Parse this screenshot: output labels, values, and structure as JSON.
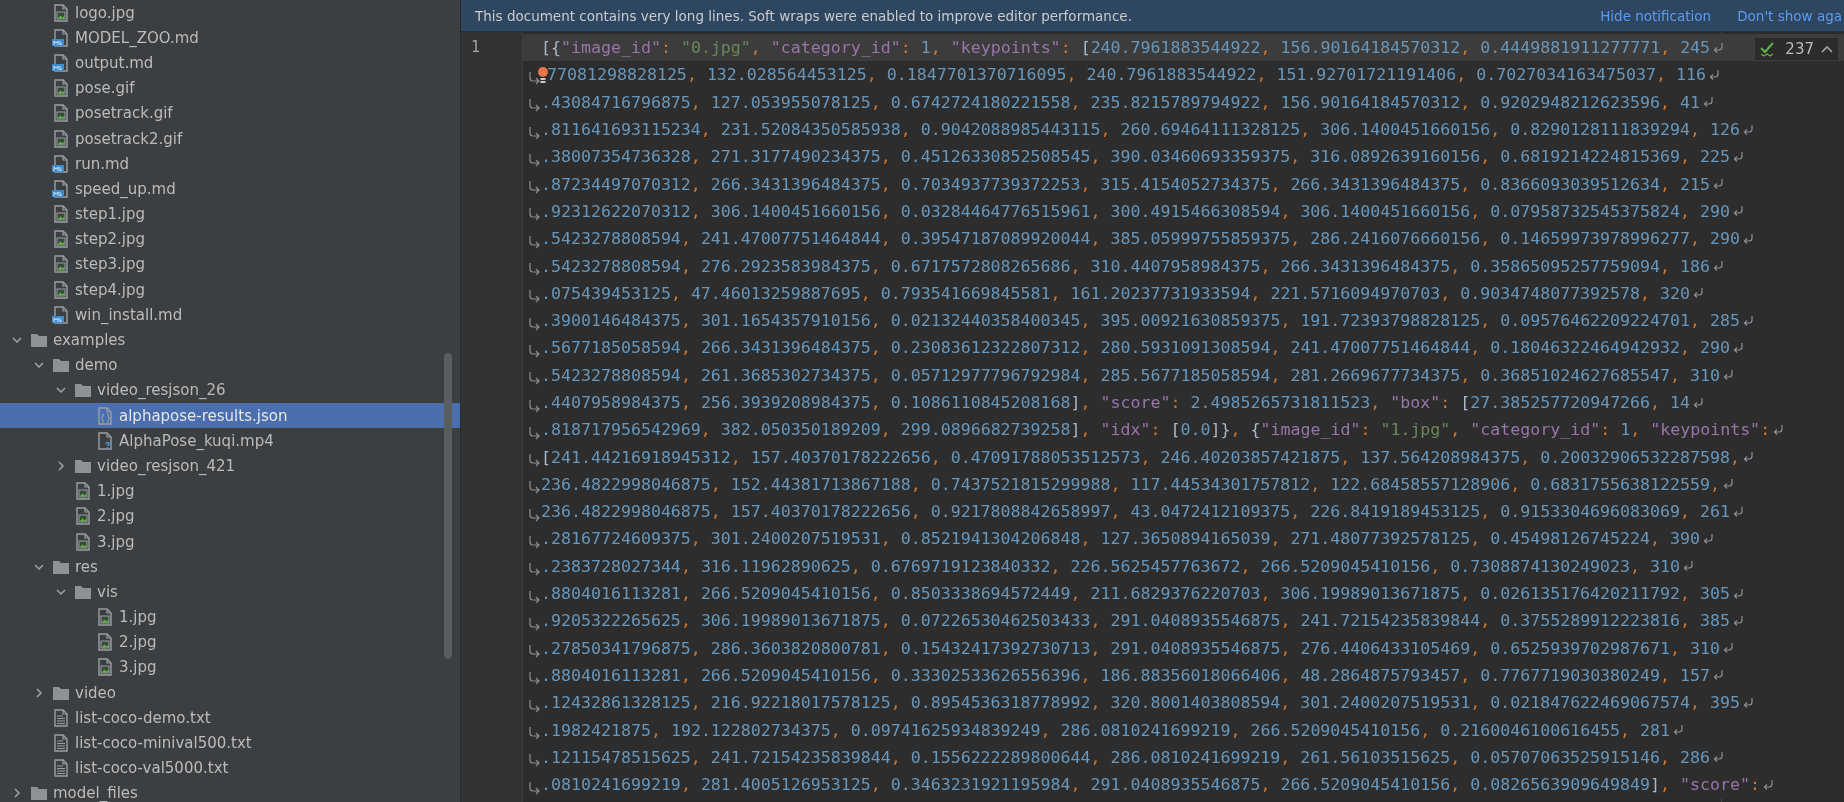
{
  "project_tree": {
    "items": [
      {
        "expanded": true,
        "children": [
          {
            "label": "logo.jpg",
            "kind": "image",
            "selected": false
          },
          {
            "label": "MODEL_ZOO.md",
            "kind": "markdown",
            "selected": false
          },
          {
            "label": "output.md",
            "kind": "markdown",
            "selected": false
          },
          {
            "label": "pose.gif",
            "kind": "image",
            "selected": false
          },
          {
            "label": "posetrack.gif",
            "kind": "image",
            "selected": false
          },
          {
            "label": "posetrack2.gif",
            "kind": "image",
            "selected": false
          },
          {
            "label": "run.md",
            "kind": "markdown",
            "selected": false
          },
          {
            "label": "speed_up.md",
            "kind": "markdown",
            "selected": false
          },
          {
            "label": "step1.jpg",
            "kind": "image",
            "selected": false
          },
          {
            "label": "step2.jpg",
            "kind": "image",
            "selected": false
          },
          {
            "label": "step3.jpg",
            "kind": "image",
            "selected": false
          },
          {
            "label": "step4.jpg",
            "kind": "image",
            "selected": false
          },
          {
            "label": "win_install.md",
            "kind": "markdown",
            "selected": false
          }
        ]
      },
      {
        "label": "examples",
        "kind": "folder",
        "expanded": true,
        "selected": false,
        "children": [
          {
            "label": "demo",
            "kind": "folder",
            "expanded": true,
            "selected": false,
            "children": [
              {
                "label": "video_resjson_26",
                "kind": "folder",
                "expanded": true,
                "selected": false,
                "children": [
                  {
                    "label": "alphapose-results.json",
                    "kind": "json",
                    "selected": true
                  },
                  {
                    "label": "AlphaPose_kuqi.mp4",
                    "kind": "unknown",
                    "selected": false
                  }
                ]
              },
              {
                "label": "video_resjson_421",
                "kind": "folder",
                "expanded": false,
                "selected": false
              },
              {
                "label": "1.jpg",
                "kind": "image",
                "selected": false
              },
              {
                "label": "2.jpg",
                "kind": "image",
                "selected": false
              },
              {
                "label": "3.jpg",
                "kind": "image",
                "selected": false
              }
            ]
          },
          {
            "label": "res",
            "kind": "folder",
            "expanded": true,
            "selected": false,
            "children": [
              {
                "label": "vis",
                "kind": "folder",
                "expanded": true,
                "selected": false,
                "children": [
                  {
                    "label": "1.jpg",
                    "kind": "image",
                    "selected": false
                  },
                  {
                    "label": "2.jpg",
                    "kind": "image",
                    "selected": false
                  },
                  {
                    "label": "3.jpg",
                    "kind": "image",
                    "selected": false
                  }
                ]
              }
            ]
          },
          {
            "label": "video",
            "kind": "folder",
            "expanded": false,
            "selected": false
          },
          {
            "label": "list-coco-demo.txt",
            "kind": "text",
            "selected": false
          },
          {
            "label": "list-coco-minival500.txt",
            "kind": "text",
            "selected": false
          },
          {
            "label": "list-coco-val5000.txt",
            "kind": "text",
            "selected": false
          }
        ]
      },
      {
        "label": "model_files",
        "kind": "folder",
        "expanded": false,
        "selected": false
      }
    ]
  },
  "notification": {
    "message": "This document contains very long lines. Soft wraps were enabled to improve editor performance.",
    "actions": [
      "Hide notification",
      "Don't show aga"
    ]
  },
  "editor": {
    "line_numbers": [
      "1"
    ],
    "inspection_count": "237",
    "lines": [
      {
        "text": "[{\"image_id\": \"0.jpg\", \"category_id\": 1, \"keypoints\": [240.7961883544922, 156.90164184570312, 0.4449881911277771, 245",
        "wrap_start": false,
        "wrap_end": true,
        "bulb": false,
        "current": true
      },
      {
        "text": "77081298828125, 132.028564453125, 0.1847701370716095, 240.7961883544922, 151.92701721191406, 0.7027034163475037, 116",
        "wrap_start": true,
        "wrap_end": true,
        "bulb": true,
        "current": false
      },
      {
        "text": ".43084716796875, 127.053955078125, 0.6742724180221558, 235.8215789794922, 156.90164184570312, 0.9202948212623596, 41",
        "wrap_start": true,
        "wrap_end": true,
        "bulb": false,
        "current": false
      },
      {
        "text": ".811641693115234, 231.52084350585938, 0.9042088985443115, 260.69464111328125, 306.1400451660156, 0.8290128111839294, 126",
        "wrap_start": true,
        "wrap_end": true,
        "bulb": false,
        "current": false
      },
      {
        "text": ".38007354736328, 271.3177490234375, 0.45126330852508545, 390.03460693359375, 316.0892639160156, 0.6819214224815369, 225",
        "wrap_start": true,
        "wrap_end": true,
        "bulb": false,
        "current": false
      },
      {
        "text": ".87234497070312, 266.3431396484375, 0.7034937739372253, 315.4154052734375, 266.3431396484375, 0.8366093039512634, 215",
        "wrap_start": true,
        "wrap_end": true,
        "bulb": false,
        "current": false
      },
      {
        "text": ".92312622070312, 306.1400451660156, 0.03284464776515961, 300.4915466308594, 306.1400451660156, 0.07958732545375824, 290",
        "wrap_start": true,
        "wrap_end": true,
        "bulb": false,
        "current": false
      },
      {
        "text": ".5423278808594, 241.47007751464844, 0.39547187089920044, 385.05999755859375, 286.2416076660156, 0.14659973978996277, 290",
        "wrap_start": true,
        "wrap_end": true,
        "bulb": false,
        "current": false
      },
      {
        "text": ".5423278808594, 276.2923583984375, 0.6717572808265686, 310.4407958984375, 266.3431396484375, 0.35865095257759094, 186",
        "wrap_start": true,
        "wrap_end": true,
        "bulb": false,
        "current": false
      },
      {
        "text": ".075439453125, 47.46013259887695, 0.793541669845581, 161.20237731933594, 221.5716094970703, 0.9034748077392578, 320",
        "wrap_start": true,
        "wrap_end": true,
        "bulb": false,
        "current": false
      },
      {
        "text": ".3900146484375, 301.1654357910156, 0.02132440358400345, 395.00921630859375, 191.72393798828125, 0.09576462209224701, 285",
        "wrap_start": true,
        "wrap_end": true,
        "bulb": false,
        "current": false
      },
      {
        "text": ".5677185058594, 266.3431396484375, 0.23083612322807312, 280.5931091308594, 241.47007751464844, 0.18046322464942932, 290",
        "wrap_start": true,
        "wrap_end": true,
        "bulb": false,
        "current": false
      },
      {
        "text": ".5423278808594, 261.3685302734375, 0.05712977796792984, 285.5677185058594, 281.2669677734375, 0.36851024627685547, 310",
        "wrap_start": true,
        "wrap_end": true,
        "bulb": false,
        "current": false
      },
      {
        "text": ".4407958984375, 256.3939208984375, 0.1086110845208168], \"score\": 2.4985265731811523, \"box\": [27.385257720947266, 14",
        "wrap_start": true,
        "wrap_end": true,
        "bulb": false,
        "current": false
      },
      {
        "text": ".818717956542969, 382.050350189209, 299.0896682739258], \"idx\": [0.0]}, {\"image_id\": \"1.jpg\", \"category_id\": 1, \"keypoints\":",
        "wrap_start": true,
        "wrap_end": true,
        "bulb": false,
        "current": false
      },
      {
        "text": "[241.44216918945312, 157.40370178222656, 0.47091788053512573, 246.40203857421875, 137.564208984375, 0.20032906532287598,",
        "wrap_start": true,
        "wrap_end": true,
        "bulb": false,
        "current": false
      },
      {
        "text": "236.4822998046875, 152.44381713867188, 0.7437521815299988, 117.44534301757812, 122.68458557128906, 0.6831755638122559,",
        "wrap_start": true,
        "wrap_end": true,
        "bulb": false,
        "current": false
      },
      {
        "text": "236.4822998046875, 157.40370178222656, 0.9217808842658997, 43.0472412109375, 226.8419189453125, 0.9153304696083069, 261",
        "wrap_start": true,
        "wrap_end": true,
        "bulb": false,
        "current": false
      },
      {
        "text": ".28167724609375, 301.2400207519531, 0.8521941304206848, 127.3650894165039, 271.48077392578125, 0.45498126745224, 390",
        "wrap_start": true,
        "wrap_end": true,
        "bulb": false,
        "current": false
      },
      {
        "text": ".2383728027344, 316.11962890625, 0.6769719123840332, 226.5625457763672, 266.5209045410156, 0.7308874130249023, 310",
        "wrap_start": true,
        "wrap_end": true,
        "bulb": false,
        "current": false
      },
      {
        "text": ".8804016113281, 266.5209045410156, 0.8503338694572449, 211.6829376220703, 306.19989013671875, 0.026135176420211792, 305",
        "wrap_start": true,
        "wrap_end": true,
        "bulb": false,
        "current": false
      },
      {
        "text": ".9205322265625, 306.19989013671875, 0.07226530462503433, 291.0408935546875, 241.72154235839844, 0.3755289912223816, 385",
        "wrap_start": true,
        "wrap_end": true,
        "bulb": false,
        "current": false
      },
      {
        "text": ".27850341796875, 286.3603820800781, 0.15432417392730713, 291.0408935546875, 276.4406433105469, 0.6525939702987671, 310",
        "wrap_start": true,
        "wrap_end": true,
        "bulb": false,
        "current": false
      },
      {
        "text": ".8804016113281, 266.5209045410156, 0.33302533626556396, 186.88356018066406, 48.2864875793457, 0.7767719030380249, 157",
        "wrap_start": true,
        "wrap_end": true,
        "bulb": false,
        "current": false
      },
      {
        "text": ".12432861328125, 216.92218017578125, 0.8954536318778992, 320.8001403808594, 301.2400207519531, 0.021847622469067574, 395",
        "wrap_start": true,
        "wrap_end": true,
        "bulb": false,
        "current": false
      },
      {
        "text": ".1982421875, 192.122802734375, 0.09741625934839249, 286.0810241699219, 266.5209045410156, 0.2160046100616455, 281",
        "wrap_start": true,
        "wrap_end": true,
        "bulb": false,
        "current": false
      },
      {
        "text": ".12115478515625, 241.72154235839844, 0.1556222289800644, 286.0810241699219, 261.56103515625, 0.05707063525915146, 286",
        "wrap_start": true,
        "wrap_end": true,
        "bulb": false,
        "current": false
      },
      {
        "text": ".0810241699219, 281.4005126953125, 0.3463231921195984, 291.0408935546875, 266.5209045410156, 0.0826563909649849], \"score\":",
        "wrap_start": true,
        "wrap_end": true,
        "bulb": false,
        "current": false
      }
    ]
  }
}
